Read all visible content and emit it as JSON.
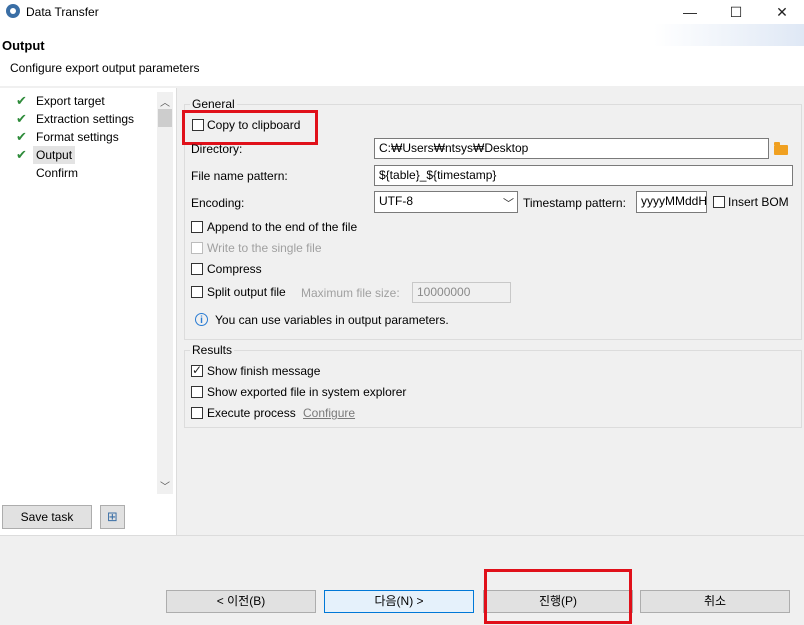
{
  "window": {
    "title": "Data Transfer"
  },
  "header": {
    "title": "Output",
    "description": "Configure export output parameters"
  },
  "nav": {
    "items": [
      {
        "label": "Export target",
        "done": true
      },
      {
        "label": "Extraction settings",
        "done": true
      },
      {
        "label": "Format settings",
        "done": true
      },
      {
        "label": "Output",
        "done": true,
        "selected": true
      },
      {
        "label": "Confirm",
        "done": false
      }
    ],
    "save_task_label": "Save task"
  },
  "general": {
    "label": "General",
    "copy_to_clipboard": {
      "label": "Copy to clipboard",
      "checked": false
    },
    "directory": {
      "label": "Directory:",
      "value": "C:₩Users₩ntsys₩Desktop"
    },
    "file_name_pattern": {
      "label": "File name pattern:",
      "value": "${table}_${timestamp}"
    },
    "encoding": {
      "label": "Encoding:",
      "value": "UTF-8"
    },
    "timestamp_pattern": {
      "label": "Timestamp pattern:",
      "value": "yyyyMMddHHmm"
    },
    "insert_bom": {
      "label": "Insert BOM",
      "checked": false
    },
    "append": {
      "label": "Append to the end of the file",
      "checked": false
    },
    "single_file": {
      "label": "Write to the single file",
      "checked": false,
      "disabled": true
    },
    "compress": {
      "label": "Compress",
      "checked": false
    },
    "split": {
      "label": "Split output file",
      "checked": false
    },
    "max_file_size": {
      "label": "Maximum file size:",
      "value": "10000000"
    },
    "info": "You can use variables in output parameters."
  },
  "results": {
    "label": "Results",
    "show_finish": {
      "label": "Show finish message",
      "checked": true
    },
    "show_exported": {
      "label": "Show exported file in system explorer",
      "checked": false
    },
    "execute_process": {
      "label": "Execute process",
      "checked": false
    },
    "configure_link": "Configure"
  },
  "footer": {
    "back": "< 이전(B)",
    "next": "다음(N) >",
    "proceed": "진행(P)",
    "cancel": "취소"
  },
  "colors": {
    "highlight": "#e0101a",
    "check": "#2e8b3a",
    "accent": "#2a7cd3"
  }
}
